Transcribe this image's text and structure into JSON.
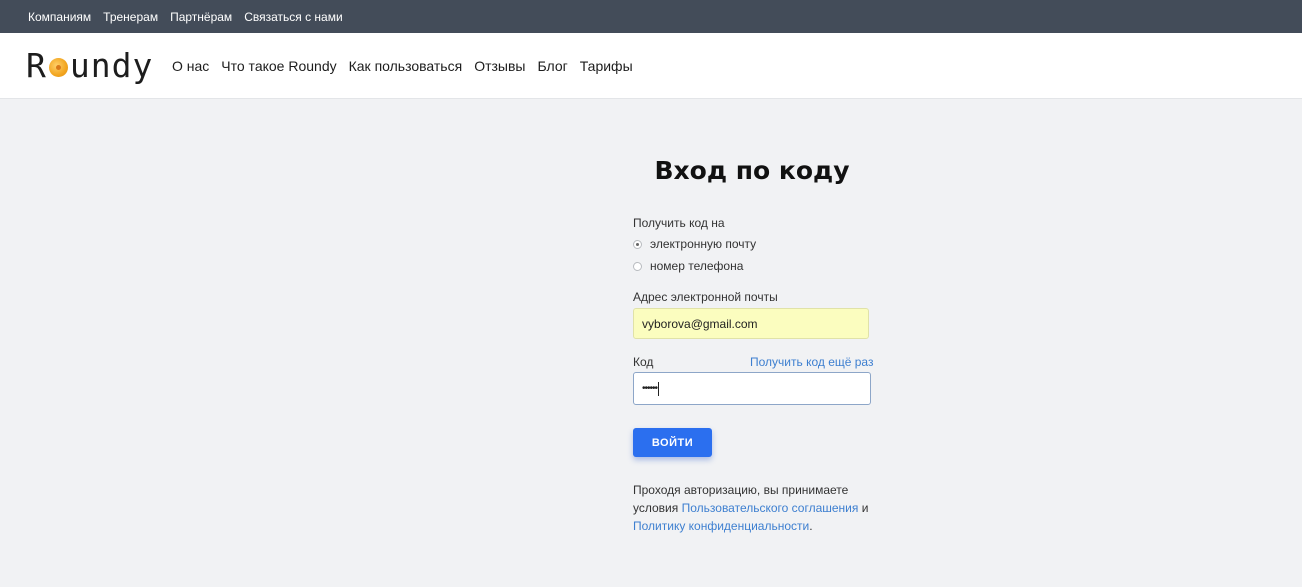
{
  "topbar": {
    "links": [
      "Компаниям",
      "Тренерам",
      "Партнёрам",
      "Связаться с нами"
    ]
  },
  "navbar": {
    "logo_left": "R",
    "logo_right": "undy",
    "links": [
      "О нас",
      "Что такое Roundy",
      "Как пользоваться",
      "Отзывы",
      "Блог",
      "Тарифы"
    ]
  },
  "form": {
    "title": "Вход по коду",
    "receive_label": "Получить код на",
    "options": [
      {
        "label": "электронную почту",
        "checked": true
      },
      {
        "label": "номер телефона",
        "checked": false
      }
    ],
    "email_label": "Адрес электронной почты",
    "email_value": "vyborova@gmail.com",
    "code_label": "Код",
    "resend_link": "Получить код ещё раз",
    "code_value": "••••••",
    "submit_label": "ВОЙТИ",
    "terms_prefix": "Проходя авторизацию, вы принимаете условия",
    "terms_link1": "Пользовательского соглашения",
    "terms_and": "и",
    "terms_link2": "Политику конфиденциальности",
    "terms_end": "."
  },
  "colors": {
    "topbar_bg": "#434c59",
    "accent": "#2b6fef",
    "link": "#3d7fd0",
    "autofill_bg": "#fbfdbf"
  }
}
